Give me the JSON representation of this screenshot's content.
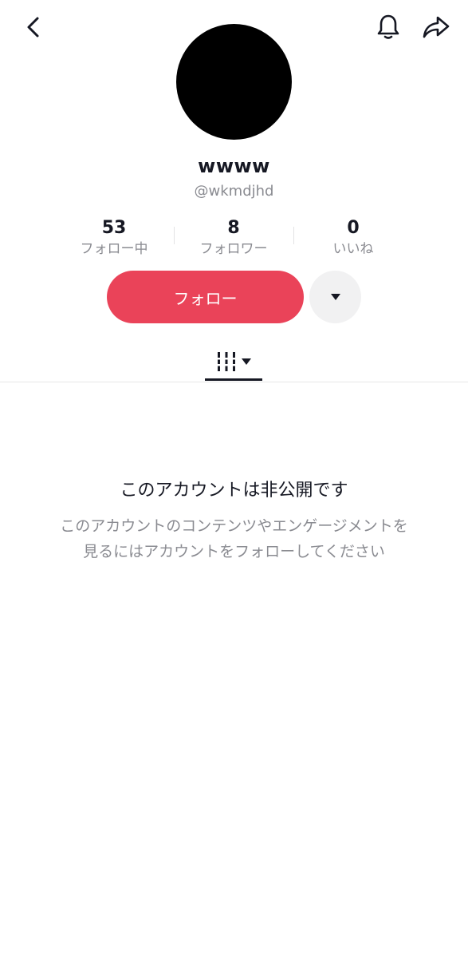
{
  "header": {
    "back_icon": "chevron-left-icon",
    "bell_icon": "bell-icon",
    "share_icon": "share-arrow-icon"
  },
  "profile": {
    "display_name": "wwww",
    "username": "@wkmdjhd"
  },
  "stats": [
    {
      "value": "53",
      "label": "フォロー中"
    },
    {
      "value": "8",
      "label": "フォロワー"
    },
    {
      "value": "0",
      "label": "いいね"
    }
  ],
  "actions": {
    "follow_label": "フォロー",
    "follow_color": "#ea4359",
    "more_icon": "caret-down-icon"
  },
  "tabs": {
    "active_icon": "videos-grid-icon"
  },
  "private_notice": {
    "title": "このアカウントは非公開です",
    "line1": "このアカウントのコンテンツやエンゲージメントを",
    "line2": "見るにはアカウントをフォローしてください"
  }
}
